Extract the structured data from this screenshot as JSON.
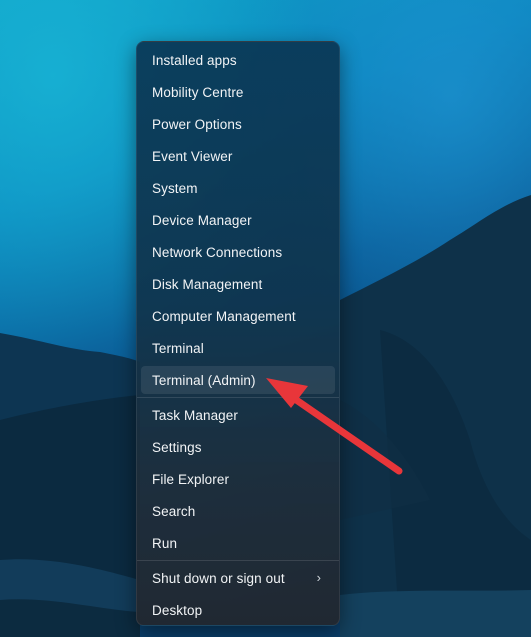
{
  "desktop": {
    "wallpaper": "night-mountains-blue-sky"
  },
  "menu": {
    "groups": [
      [
        {
          "label": "Installed apps"
        },
        {
          "label": "Mobility Centre"
        },
        {
          "label": "Power Options"
        },
        {
          "label": "Event Viewer"
        },
        {
          "label": "System"
        },
        {
          "label": "Device Manager"
        },
        {
          "label": "Network Connections"
        },
        {
          "label": "Disk Management"
        },
        {
          "label": "Computer Management"
        },
        {
          "label": "Terminal"
        },
        {
          "label": "Terminal (Admin)",
          "selected": true
        }
      ],
      [
        {
          "label": "Task Manager"
        },
        {
          "label": "Settings"
        },
        {
          "label": "File Explorer"
        },
        {
          "label": "Search"
        },
        {
          "label": "Run"
        }
      ],
      [
        {
          "label": "Shut down or sign out",
          "submenu": true,
          "icon": "chevron-right-icon"
        },
        {
          "label": "Desktop"
        }
      ]
    ]
  },
  "annotation": {
    "type": "arrow",
    "color": "#e8363a",
    "points_to": "Terminal (Admin)"
  },
  "colors": {
    "menu_text": "#f2f4f6",
    "highlight": "rgba(255,255,255,0.085)"
  }
}
